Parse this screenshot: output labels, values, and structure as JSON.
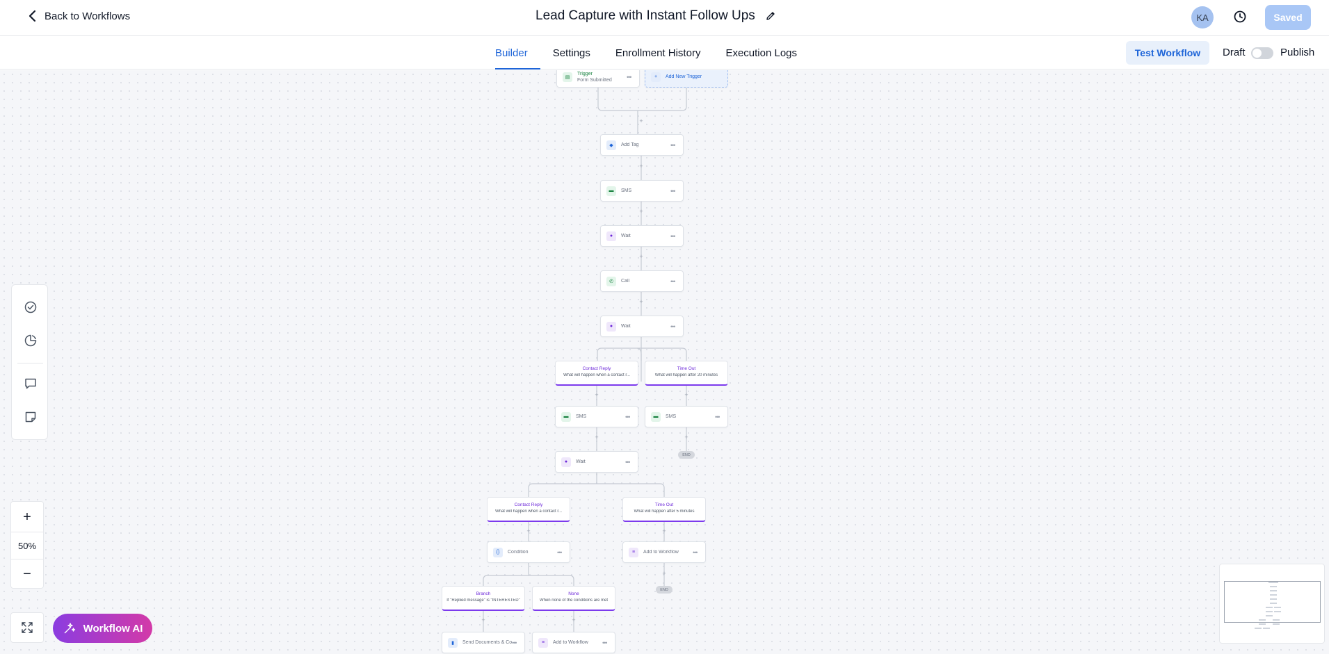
{
  "header": {
    "back_label": "Back to Workflows",
    "title": "Lead Capture with Instant Follow Ups",
    "avatar_initials": "KA",
    "saved_label": "Saved"
  },
  "tabs": [
    {
      "label": "Builder",
      "active": true
    },
    {
      "label": "Settings",
      "active": false
    },
    {
      "label": "Enrollment History",
      "active": false
    },
    {
      "label": "Execution Logs",
      "active": false
    }
  ],
  "actions": {
    "test_label": "Test Workflow",
    "draft_label": "Draft",
    "publish_label": "Publish",
    "published": false
  },
  "canvas": {
    "trigger": {
      "title": "Trigger",
      "subtitle": "Form Submitted"
    },
    "add_trigger": "Add New Trigger",
    "nodes": {
      "add_tag": "Add Tag",
      "sms_1": "SMS",
      "wait_1": "Wait",
      "call": "Call",
      "wait_2": "Wait",
      "sms_2": "SMS",
      "sms_3": "SMS",
      "wait_3": "Wait",
      "condition": "Condition",
      "add_to_workflow_1": "Add to Workflow",
      "send_documents": "Send Documents & Contracts",
      "add_to_workflow_2": "Add to Workflow"
    },
    "branches": {
      "contact_reply_1": {
        "title": "Contact Reply",
        "subtitle": "What will happen when a contact r..."
      },
      "time_out_1": {
        "title": "Time Out",
        "subtitle": "What will happen after 20 minutes"
      },
      "contact_reply_2": {
        "title": "Contact Reply",
        "subtitle": "What will happen when a contact r..."
      },
      "time_out_2": {
        "title": "Time Out",
        "subtitle": "What will happen after 5 minutes"
      },
      "branch": {
        "title": "Branch",
        "subtitle": "If \"Replied message\" is \"INTERESTED\""
      },
      "none": {
        "title": "None",
        "subtitle": "When none of the conditions are met"
      }
    },
    "end_label": "END"
  },
  "zoom": {
    "level": "50%"
  },
  "ai_button": "Workflow AI",
  "colors": {
    "accent": "#1d64d8",
    "branch_border": "#7c3aed",
    "ai_gradient_start": "#8b3ce0",
    "ai_gradient_end": "#d33aa8"
  }
}
